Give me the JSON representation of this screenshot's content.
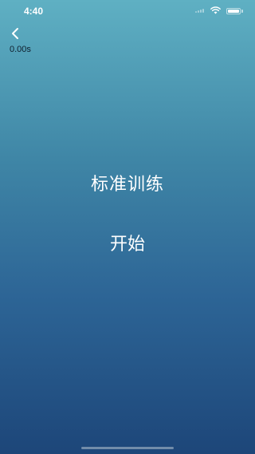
{
  "status_bar": {
    "time": "4:40",
    "icons": [
      "cellular-signal-icon",
      "wifi-icon",
      "battery-icon"
    ]
  },
  "nav": {
    "back_icon": "chevron-left-icon"
  },
  "timer": {
    "value": "0.00s"
  },
  "main": {
    "mode_title": "标准训练",
    "start_label": "开始"
  },
  "colors": {
    "gradient_top": "#5fb0c3",
    "gradient_bottom": "#1d4679",
    "text": "#ffffff",
    "timer_text": "#0f1f2e"
  }
}
